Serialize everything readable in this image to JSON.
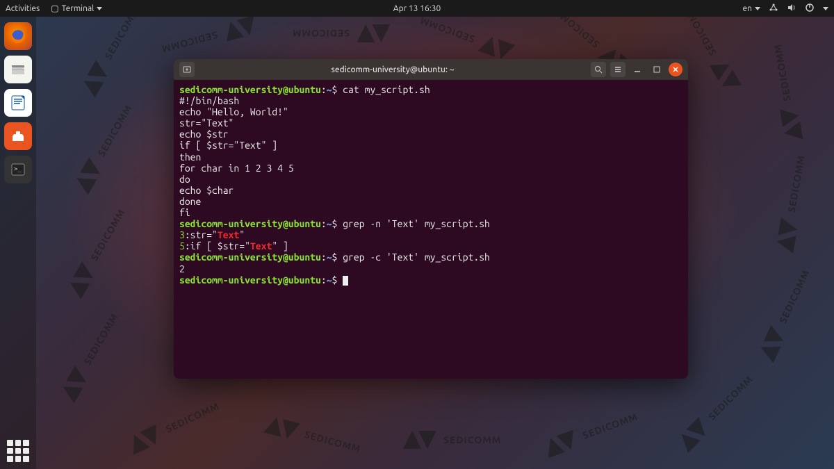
{
  "topbar": {
    "activities": "Activities",
    "terminal_label": "Terminal",
    "datetime": "Apr 13  16:30",
    "lang": "en"
  },
  "dock": {
    "items": [
      "firefox",
      "files",
      "libreoffice-writer",
      "software",
      "terminal"
    ]
  },
  "window": {
    "title": "sedicomm-university@ubuntu: ~"
  },
  "prompt": {
    "userhost": "sedicomm-university@ubuntu",
    "sep": ":",
    "path": "~",
    "sigil": "$"
  },
  "commands": {
    "c1": " cat my_script.sh",
    "c2": " grep -n 'Text' my_script.sh",
    "c3": " grep -c 'Text' my_script.sh"
  },
  "script_lines": [
    "#!/bin/bash",
    "echo \"Hello, World!\"",
    "str=\"Text\"",
    "echo $str",
    "if [ $str=\"Text\" ]",
    "then",
    "for char in 1 2 3 4 5",
    "do",
    "echo $char",
    "done",
    "fi"
  ],
  "grep_n": [
    {
      "n": "3",
      "pre": "str=\"",
      "hl": "Text",
      "post": "\""
    },
    {
      "n": "5",
      "pre": "if [ $str=\"",
      "hl": "Text",
      "post": "\" ]"
    }
  ],
  "grep_c": "2"
}
